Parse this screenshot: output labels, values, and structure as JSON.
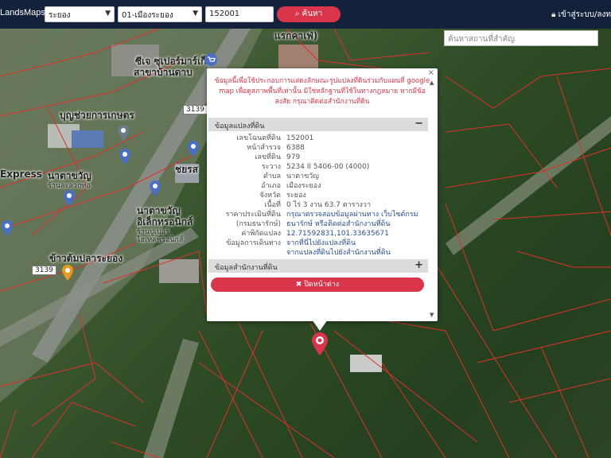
{
  "brand": "LandsMaps",
  "filters": {
    "province": "ระยอง",
    "district": "01-เมืองระยอง",
    "parcel_no": "152001",
    "search_label": "ค้นหา"
  },
  "login_label": "เข้าสู่ระบบ/ลงท",
  "landmark_search_placeholder": "ค้นหาสถานที่สำคัญ",
  "map_labels": {
    "l1": "แรกคาเฟ่)",
    "l2": "ซีเจ ซุเปอร์มาร์เก็ต",
    "l3": "สาขาบ้านดาบ",
    "l4": "บุญช่วยการเกษตร",
    "l5": "Express",
    "l6": "นาตาขวัญ",
    "l7": "ร้านละลวกท่อ",
    "l8": "ชยรส",
    "l9": "นาตาขวัญ",
    "l10": "อิเล็กทรอนิกส์",
    "l11": "ร้านปูเปอร์",
    "l12": "ไฮเทคพรอนิกส์",
    "l13": "ข้าวต้มปลาระยอง",
    "road1": "3139",
    "road2": "3139"
  },
  "popup": {
    "notice": "ข้อมูลนี้เพื่อใช้ประกอบการแสดงลักษณะรูปแปลงที่ดินร่วมกับแผนที่ google map เพื่อดูสภาพพื้นที่เท่านั้น มิใช่หลักฐานที่ใช้ในทางกฎหมาย หากมีข้อสงสัย กรุณาติดต่อสำนักงานที่ดิน",
    "section_parcel": "ข้อมูลแปลงที่ดิน",
    "section_office": "ข้อมูลสำนักงานที่ดิน",
    "collapse_symbol": "−",
    "expand_symbol": "+",
    "rows": [
      {
        "key": "เลขโฉนดที่ดิน",
        "value": "152001"
      },
      {
        "key": "หน้าสำรวจ",
        "value": "6388"
      },
      {
        "key": "เลขที่ดิน",
        "value": "979"
      },
      {
        "key": "ระวาง",
        "value": "5234 II 5406-00 (4000)"
      },
      {
        "key": "ตำบล",
        "value": "นาตาขวัญ"
      },
      {
        "key": "อำเภอ",
        "value": "เมืองระยอง"
      },
      {
        "key": "จังหวัด",
        "value": "ระยอง"
      },
      {
        "key": "เนื้อที่",
        "value": "0 ไร่ 3 งาน 63.7 ตารางวา"
      },
      {
        "key": "ราคาประเมินที่ดิน",
        "value": "กรุณาตรวจสอบข้อมูลผ่านทาง เว็บไซต์กรม"
      },
      {
        "key": "(กรมธนารักษ์)",
        "value": "ธนารักษ์ หรือติดต่อสำนักงานที่ดิน"
      },
      {
        "key": "ค่าพิกัดแปลง",
        "value": "12.71592831,101.33635671"
      },
      {
        "key": "ข้อมูลการเดินทาง",
        "value": "จากที่นี่ไปยังแปลงที่ดิน"
      },
      {
        "key": "",
        "value": "จากแปลงที่ดินไปยังสำนักงานที่ดิน"
      }
    ],
    "close_label": "✖ ปิดหน้าต่าง",
    "close_x": "×"
  },
  "colors": {
    "topbar": "#13213a",
    "accent": "#d9354b",
    "parcel_line": "#e0302a"
  }
}
